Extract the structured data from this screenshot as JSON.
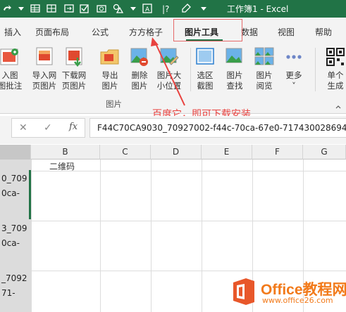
{
  "window": {
    "title": "工作簿1  -  Excel"
  },
  "ribbon_tabs": [
    {
      "label": "插入"
    },
    {
      "label": "页面布局"
    },
    {
      "label": "公式"
    },
    {
      "label": "方方格子"
    },
    {
      "label": "图片工具"
    },
    {
      "label": "数据"
    },
    {
      "label": "视图"
    },
    {
      "label": "帮助"
    }
  ],
  "ribbon_buttons": [
    {
      "line1": "入图",
      "line2": "图批注"
    },
    {
      "line1": "导入网",
      "line2": "页图片"
    },
    {
      "line1": "下载网",
      "line2": "页图片"
    },
    {
      "line1": "导出",
      "line2": "图片"
    },
    {
      "line1": "删除",
      "line2": "图片"
    },
    {
      "line1": "图片大",
      "line2": "小位置"
    },
    {
      "line1": "选区",
      "line2": "截图"
    },
    {
      "line1": "图片",
      "line2": "查找"
    },
    {
      "line1": "图片",
      "line2": "阅览"
    },
    {
      "line1": "更多",
      "line2": "˅"
    },
    {
      "line1": "单个",
      "line2": "生成"
    }
  ],
  "ribbon_group": {
    "label": "图片"
  },
  "annotation": {
    "text": "百度它，即可下载安装"
  },
  "formula_bar": {
    "cancel": "✕",
    "confirm": "✓",
    "fx": "fx",
    "value": "F44C70CA9030_70927002-f44c-70ca-67e0-717430028694"
  },
  "columns": [
    "B",
    "C",
    "D",
    "E",
    "F",
    "G"
  ],
  "cells": {
    "B1": "二维码",
    "A_rows": [
      "0_709",
      "0ca-",
      "3_709",
      "0ca-",
      "_7092",
      "71-"
    ]
  },
  "watermark": {
    "brand": "Office教程网",
    "url": "www.office26.com"
  }
}
